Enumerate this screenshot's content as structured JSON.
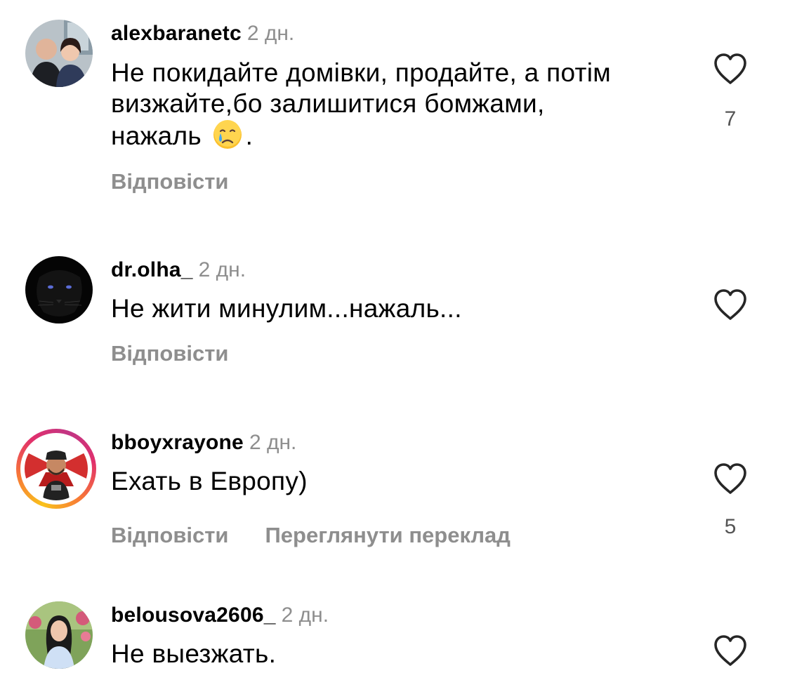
{
  "comments": [
    {
      "username": "alexbaranetc",
      "time": "2 дн.",
      "text_lines": [
        "Не покидайте домівки, продайте, а потім",
        "визжайте,бо залишитися  бомжами,",
        "нажаль"
      ],
      "text_end": ".",
      "emoji": "crying-face-emoji",
      "likes": "7",
      "reply_label": "Відповісти"
    },
    {
      "username": "dr.olha_",
      "time": "2 дн.",
      "text": "Не жити минулим...нажаль...",
      "likes": "",
      "reply_label": "Відповісти"
    },
    {
      "username": "bboyxrayone",
      "time": "2 дн.",
      "text": "Ехать в Европу)",
      "likes": "5",
      "reply_label": "Відповісти",
      "translate_label": "Переглянути переклад"
    },
    {
      "username": "belousova2606_",
      "time": "2 дн.",
      "text": "Не выезжать.",
      "likes": ""
    }
  ],
  "icons": {
    "like": "heart-outline-icon"
  },
  "colors": {
    "secondary_text": "#8e8e8e",
    "story_ring": "#e1306c"
  }
}
